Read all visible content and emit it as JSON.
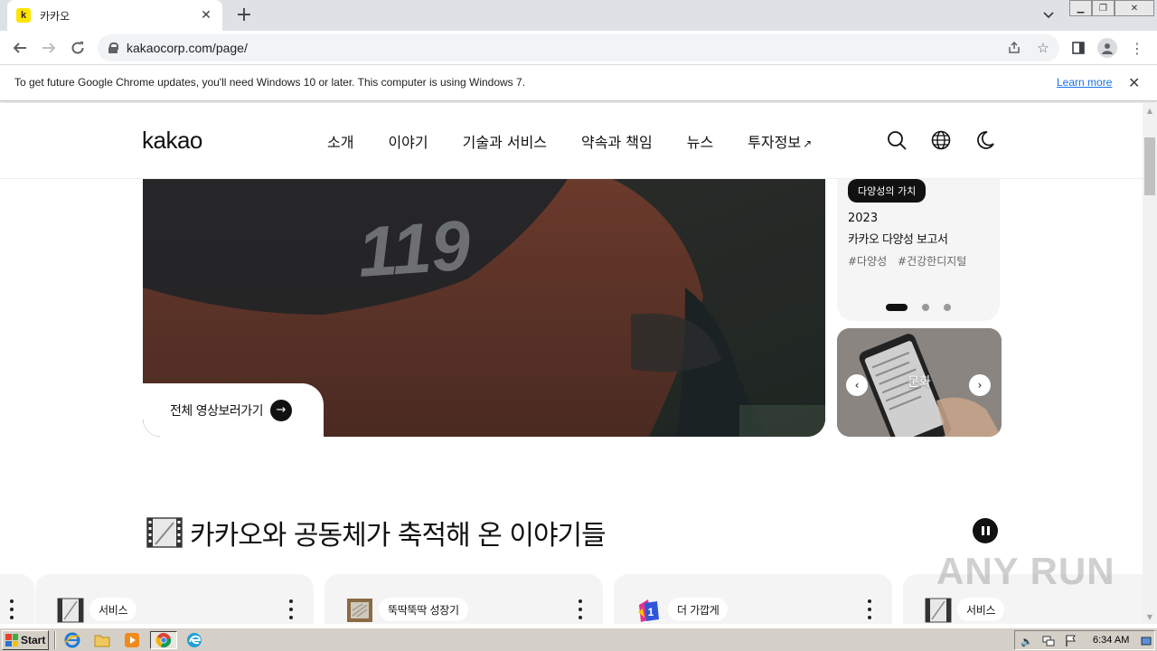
{
  "browser": {
    "tab_title": "카카오",
    "tab_favicon_letter": "k",
    "new_tab_icon": "+",
    "url": "kakaocorp.com/page/",
    "infobar_text": "To get future Google Chrome updates, you'll need Windows 10 or later. This computer is using Windows 7.",
    "infobar_link": "Learn more"
  },
  "site": {
    "logo": "kakao",
    "nav": [
      {
        "label": "소개"
      },
      {
        "label": "이야기"
      },
      {
        "label": "기술과 서비스"
      },
      {
        "label": "약속과 책임"
      },
      {
        "label": "뉴스"
      },
      {
        "label": "투자정보",
        "external_icon": "↗"
      }
    ],
    "hero_cta": "전체 영상보러가기",
    "hero_jacket_text": "119",
    "news_card": {
      "badge": "다양성의 가치",
      "year": "2023",
      "title": "카카오 다양성 보고서",
      "tags": [
        "#다양성",
        "#건강한디지털"
      ],
      "carousel_active_index": 0,
      "carousel_count": 3
    },
    "culture_card": {
      "label": "문화"
    },
    "stories": {
      "heading": "카카오와 공동체가 축적해 온 이야기들",
      "cards": [
        {
          "tag": "서비스",
          "icon": "film-icon"
        },
        {
          "tag": "뚝딱뚝딱 성장기",
          "icon": "picture-frame-icon"
        },
        {
          "tag": "더 가깝게",
          "icon": "number-one-badge-icon"
        },
        {
          "tag": "서비스",
          "icon": "film-icon"
        }
      ]
    },
    "watermark": "ANY RUN"
  },
  "taskbar": {
    "start_label": "Start",
    "clock": "6:34 AM"
  },
  "colors": {
    "kakao_yellow": "#fee500",
    "link_blue": "#1a73e8",
    "dark": "#111111"
  }
}
